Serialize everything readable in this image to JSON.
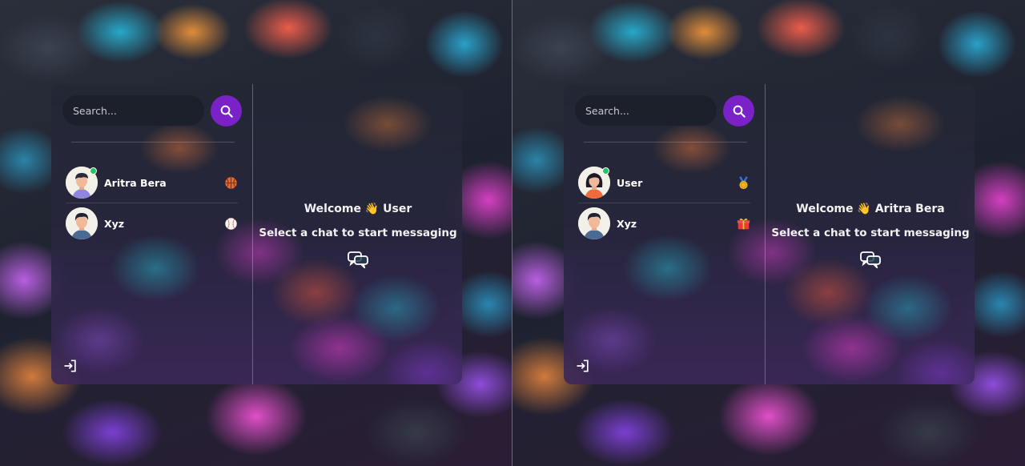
{
  "panels": [
    {
      "search": {
        "placeholder": "Search..."
      },
      "conversations": [
        {
          "name": "Aritra Bera",
          "emoji": "basketball-icon",
          "online": true,
          "avatar": "male-avatar"
        },
        {
          "name": "Xyz",
          "emoji": "baseball-icon",
          "online": false,
          "avatar": "male-avatar"
        }
      ],
      "welcome": {
        "prefix": "Welcome",
        "wave": "👋",
        "name": "User"
      },
      "subtitle": "Select a chat to start messaging"
    },
    {
      "search": {
        "placeholder": "Search..."
      },
      "conversations": [
        {
          "name": "User",
          "emoji": "medal-icon",
          "online": true,
          "avatar": "female-avatar"
        },
        {
          "name": "Xyz",
          "emoji": "gift-icon",
          "online": false,
          "avatar": "male-avatar"
        }
      ],
      "welcome": {
        "prefix": "Welcome",
        "wave": "👋",
        "name": "Aritra Bera"
      },
      "subtitle": "Select a chat to start messaging"
    }
  ],
  "colors": {
    "accent": "#7a22c8",
    "online": "#22c55e",
    "text": "#ffffff"
  }
}
